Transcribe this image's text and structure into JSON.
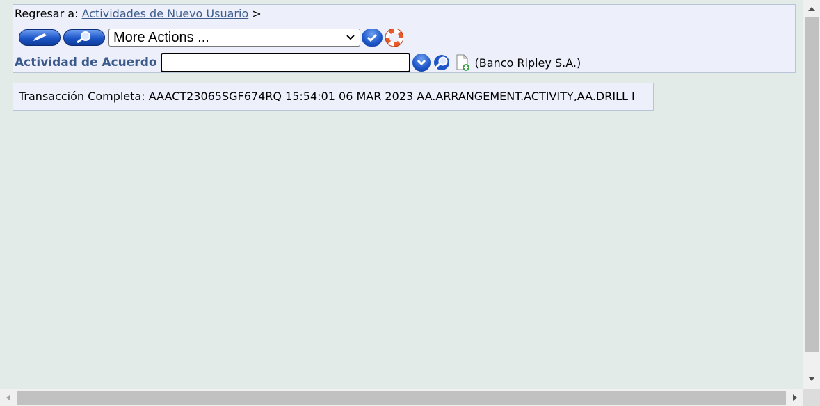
{
  "breadcrumb": {
    "prefix": "Regresar a:",
    "link": "Actividades de Nuevo Usuario",
    "separator": ">"
  },
  "toolbar": {
    "edit_icon": "pencil-icon",
    "view_icon": "magnifier-icon",
    "more_actions": "More Actions ...",
    "go_icon": "check-icon",
    "help_icon": "lifebuoy-icon"
  },
  "record": {
    "label": "Actividad de Acuerdo",
    "input_value": "",
    "dropdown_icon": "chevron-down-icon",
    "search_icon": "magnifier-icon",
    "new_icon": "new-document-icon",
    "company": "(Banco Ripley S.A.)"
  },
  "message": {
    "text": "Transacción Completa: AAACT23065SGF674RQ 15:54:01 06 MAR 2023 AA.ARRANGEMENT.ACTIVITY,AA.DRILL I"
  },
  "colors": {
    "link": "#3e5d8d",
    "label": "#3b5a8c",
    "button_blue": "#1d56c8",
    "panel_bg": "#edf0fb",
    "page_bg": "#e3ebe8"
  }
}
